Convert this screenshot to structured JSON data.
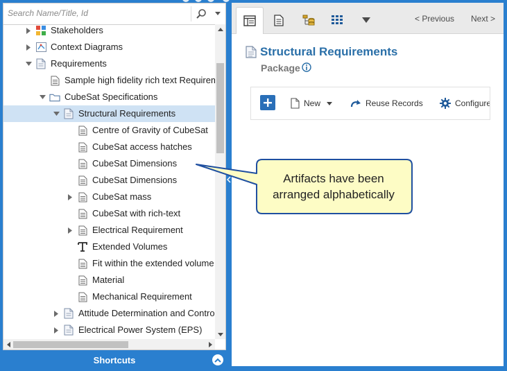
{
  "search": {
    "placeholder": "Search Name/Title, Id"
  },
  "tree": [
    {
      "label": "Stakeholders",
      "level": 1,
      "arrow": "right",
      "icon": "stakeholders-icon"
    },
    {
      "label": "Context Diagrams",
      "level": 1,
      "arrow": "right",
      "icon": "diagram-icon"
    },
    {
      "label": "Requirements",
      "level": 1,
      "arrow": "down",
      "icon": "package-icon"
    },
    {
      "label": "Sample high fidelity rich text Requirements",
      "level": 2,
      "arrow": "none",
      "icon": "document-icon"
    },
    {
      "label": "CubeSat Specifications",
      "level": 2,
      "arrow": "down",
      "icon": "folder-icon"
    },
    {
      "label": "Structural Requirements",
      "level": 3,
      "arrow": "down",
      "icon": "package-icon",
      "selected": true
    },
    {
      "label": "Centre of Gravity of CubeSat",
      "level": 4,
      "arrow": "none",
      "icon": "document-icon"
    },
    {
      "label": "CubeSat access hatches",
      "level": 4,
      "arrow": "none",
      "icon": "document-icon"
    },
    {
      "label": "CubeSat Dimensions",
      "level": 4,
      "arrow": "none",
      "icon": "document-icon"
    },
    {
      "label": "CubeSat Dimensions",
      "level": 4,
      "arrow": "none",
      "icon": "document-icon"
    },
    {
      "label": "CubeSat mass",
      "level": 4,
      "arrow": "right",
      "icon": "document-icon"
    },
    {
      "label": "CubeSat with rich-text",
      "level": 4,
      "arrow": "none",
      "icon": "document-icon"
    },
    {
      "label": "Electrical Requirement",
      "level": 4,
      "arrow": "right",
      "icon": "document-icon"
    },
    {
      "label": "Extended Volumes",
      "level": 4,
      "arrow": "none",
      "icon": "text-type-icon"
    },
    {
      "label": "Fit within the extended volume",
      "level": 4,
      "arrow": "none",
      "icon": "document-icon"
    },
    {
      "label": "Material",
      "level": 4,
      "arrow": "none",
      "icon": "document-icon"
    },
    {
      "label": "Mechanical Requirement",
      "level": 4,
      "arrow": "none",
      "icon": "document-icon"
    },
    {
      "label": "Attitude Determination and Control",
      "level": 3,
      "arrow": "right",
      "icon": "package-icon"
    },
    {
      "label": "Electrical Power System (EPS)",
      "level": 3,
      "arrow": "right",
      "icon": "package-icon"
    }
  ],
  "shortcuts": {
    "label": "Shortcuts"
  },
  "nav": {
    "previous": "< Previous",
    "next": "Next >"
  },
  "record": {
    "title": "Structural Requirements",
    "type": "Package"
  },
  "toolbar": {
    "new_label": "New",
    "reuse_label": "Reuse Records",
    "configure_label": "Configure"
  },
  "callout": {
    "line1": "Artifacts have been",
    "line2": "arranged alphabetically"
  },
  "colors": {
    "accent": "#2a7fcf",
    "title": "#2a6fa8",
    "selection": "#cfe2f4",
    "callout_fill": "#fdfcc5",
    "callout_border": "#1f4fa0"
  }
}
